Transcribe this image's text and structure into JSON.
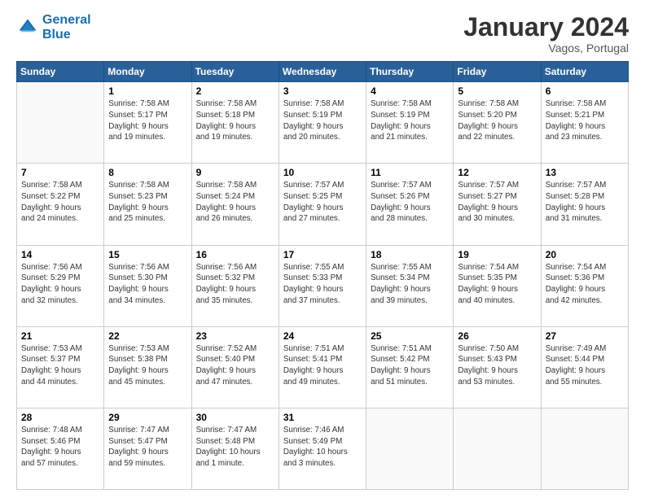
{
  "logo": {
    "line1": "General",
    "line2": "Blue"
  },
  "title": "January 2024",
  "subtitle": "Vagos, Portugal",
  "days_of_week": [
    "Sunday",
    "Monday",
    "Tuesday",
    "Wednesday",
    "Thursday",
    "Friday",
    "Saturday"
  ],
  "weeks": [
    [
      {
        "day": "",
        "info": ""
      },
      {
        "day": "1",
        "info": "Sunrise: 7:58 AM\nSunset: 5:17 PM\nDaylight: 9 hours\nand 19 minutes."
      },
      {
        "day": "2",
        "info": "Sunrise: 7:58 AM\nSunset: 5:18 PM\nDaylight: 9 hours\nand 19 minutes."
      },
      {
        "day": "3",
        "info": "Sunrise: 7:58 AM\nSunset: 5:19 PM\nDaylight: 9 hours\nand 20 minutes."
      },
      {
        "day": "4",
        "info": "Sunrise: 7:58 AM\nSunset: 5:19 PM\nDaylight: 9 hours\nand 21 minutes."
      },
      {
        "day": "5",
        "info": "Sunrise: 7:58 AM\nSunset: 5:20 PM\nDaylight: 9 hours\nand 22 minutes."
      },
      {
        "day": "6",
        "info": "Sunrise: 7:58 AM\nSunset: 5:21 PM\nDaylight: 9 hours\nand 23 minutes."
      }
    ],
    [
      {
        "day": "7",
        "info": "Sunrise: 7:58 AM\nSunset: 5:22 PM\nDaylight: 9 hours\nand 24 minutes."
      },
      {
        "day": "8",
        "info": "Sunrise: 7:58 AM\nSunset: 5:23 PM\nDaylight: 9 hours\nand 25 minutes."
      },
      {
        "day": "9",
        "info": "Sunrise: 7:58 AM\nSunset: 5:24 PM\nDaylight: 9 hours\nand 26 minutes."
      },
      {
        "day": "10",
        "info": "Sunrise: 7:57 AM\nSunset: 5:25 PM\nDaylight: 9 hours\nand 27 minutes."
      },
      {
        "day": "11",
        "info": "Sunrise: 7:57 AM\nSunset: 5:26 PM\nDaylight: 9 hours\nand 28 minutes."
      },
      {
        "day": "12",
        "info": "Sunrise: 7:57 AM\nSunset: 5:27 PM\nDaylight: 9 hours\nand 30 minutes."
      },
      {
        "day": "13",
        "info": "Sunrise: 7:57 AM\nSunset: 5:28 PM\nDaylight: 9 hours\nand 31 minutes."
      }
    ],
    [
      {
        "day": "14",
        "info": "Sunrise: 7:56 AM\nSunset: 5:29 PM\nDaylight: 9 hours\nand 32 minutes."
      },
      {
        "day": "15",
        "info": "Sunrise: 7:56 AM\nSunset: 5:30 PM\nDaylight: 9 hours\nand 34 minutes."
      },
      {
        "day": "16",
        "info": "Sunrise: 7:56 AM\nSunset: 5:32 PM\nDaylight: 9 hours\nand 35 minutes."
      },
      {
        "day": "17",
        "info": "Sunrise: 7:55 AM\nSunset: 5:33 PM\nDaylight: 9 hours\nand 37 minutes."
      },
      {
        "day": "18",
        "info": "Sunrise: 7:55 AM\nSunset: 5:34 PM\nDaylight: 9 hours\nand 39 minutes."
      },
      {
        "day": "19",
        "info": "Sunrise: 7:54 AM\nSunset: 5:35 PM\nDaylight: 9 hours\nand 40 minutes."
      },
      {
        "day": "20",
        "info": "Sunrise: 7:54 AM\nSunset: 5:36 PM\nDaylight: 9 hours\nand 42 minutes."
      }
    ],
    [
      {
        "day": "21",
        "info": "Sunrise: 7:53 AM\nSunset: 5:37 PM\nDaylight: 9 hours\nand 44 minutes."
      },
      {
        "day": "22",
        "info": "Sunrise: 7:53 AM\nSunset: 5:38 PM\nDaylight: 9 hours\nand 45 minutes."
      },
      {
        "day": "23",
        "info": "Sunrise: 7:52 AM\nSunset: 5:40 PM\nDaylight: 9 hours\nand 47 minutes."
      },
      {
        "day": "24",
        "info": "Sunrise: 7:51 AM\nSunset: 5:41 PM\nDaylight: 9 hours\nand 49 minutes."
      },
      {
        "day": "25",
        "info": "Sunrise: 7:51 AM\nSunset: 5:42 PM\nDaylight: 9 hours\nand 51 minutes."
      },
      {
        "day": "26",
        "info": "Sunrise: 7:50 AM\nSunset: 5:43 PM\nDaylight: 9 hours\nand 53 minutes."
      },
      {
        "day": "27",
        "info": "Sunrise: 7:49 AM\nSunset: 5:44 PM\nDaylight: 9 hours\nand 55 minutes."
      }
    ],
    [
      {
        "day": "28",
        "info": "Sunrise: 7:48 AM\nSunset: 5:46 PM\nDaylight: 9 hours\nand 57 minutes."
      },
      {
        "day": "29",
        "info": "Sunrise: 7:47 AM\nSunset: 5:47 PM\nDaylight: 9 hours\nand 59 minutes."
      },
      {
        "day": "30",
        "info": "Sunrise: 7:47 AM\nSunset: 5:48 PM\nDaylight: 10 hours\nand 1 minute."
      },
      {
        "day": "31",
        "info": "Sunrise: 7:46 AM\nSunset: 5:49 PM\nDaylight: 10 hours\nand 3 minutes."
      },
      {
        "day": "",
        "info": ""
      },
      {
        "day": "",
        "info": ""
      },
      {
        "day": "",
        "info": ""
      }
    ]
  ]
}
